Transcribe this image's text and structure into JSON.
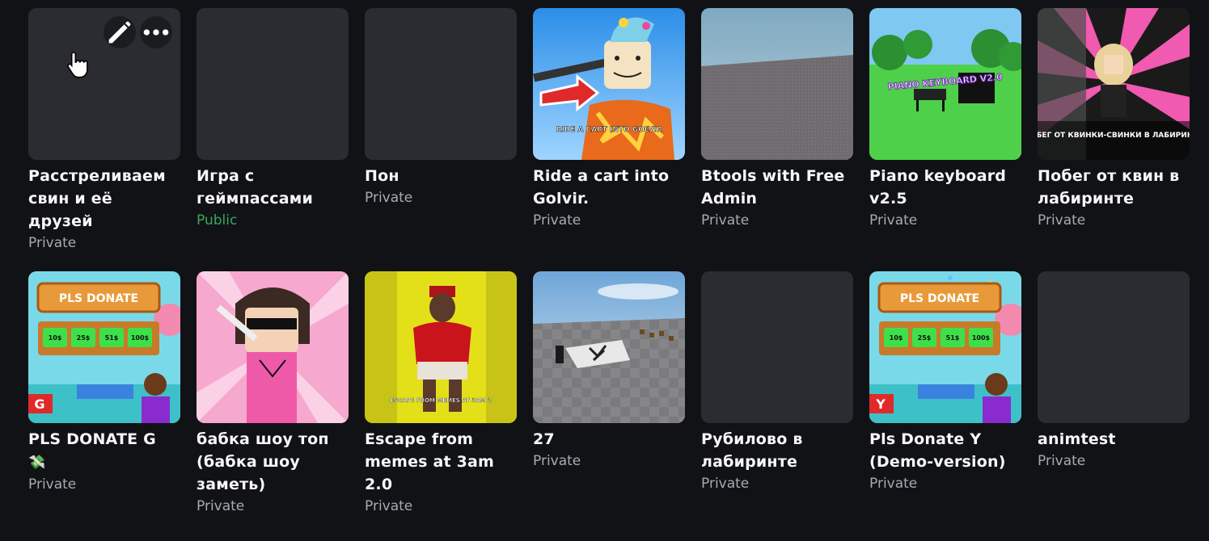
{
  "games": [
    {
      "title": "Расстреливаем свин и её друзей",
      "status": "Private",
      "public": false
    },
    {
      "title": "Игра с геймпассами",
      "status": "Public",
      "public": true
    },
    {
      "title": "Пон",
      "status": "Private",
      "public": false
    },
    {
      "title": "Ride a cart into Golvir.",
      "status": "Private",
      "public": false,
      "thumb_caption": "RIDE A CART INTO GOLVIR"
    },
    {
      "title": "Btools with Free Admin",
      "status": "Private",
      "public": false
    },
    {
      "title": "Piano keyboard v2.5",
      "status": "Private",
      "public": false,
      "thumb_caption": "PIANO KEYBOARD V2.0"
    },
    {
      "title": "Побег от квин в лабиринте",
      "status": "Private",
      "public": false,
      "thumb_caption": "ПОБЕГ ОТ КВИНКИ-СВИНКИ В ЛАБИРИНТЕ"
    },
    {
      "title": "PLS DONATE G",
      "title_emoji": "💸",
      "status": "Private",
      "public": false,
      "thumb_caption": "PLS DONATE",
      "thumb_badge": "G",
      "thumb_prices": [
        "10$",
        "25$",
        "51$",
        "100$"
      ]
    },
    {
      "title": "бабка шоу топ (бабка шоу заметь)",
      "status": "Private",
      "public": false
    },
    {
      "title": "Escape from memes at 3am 2.0",
      "status": "Private",
      "public": false,
      "thumb_caption": "ESCAPE FROM MEMES AT 3AM 2"
    },
    {
      "title": "27",
      "status": "Private",
      "public": false
    },
    {
      "title": "Рубилово в лабиринте",
      "status": "Private",
      "public": false
    },
    {
      "title": "Pls Donate Y (Demo-version)",
      "status": "Private",
      "public": false,
      "thumb_caption": "PLS DONATE",
      "thumb_badge": "Y",
      "thumb_prices": [
        "10$",
        "25$",
        "51$",
        "100$"
      ]
    },
    {
      "title": "animtest",
      "status": "Private",
      "public": false
    }
  ],
  "icons": {
    "edit": "pencil-icon",
    "more": "more-horizontal-icon",
    "cursor": "hand-cursor-icon"
  },
  "colors": {
    "background": "#111216",
    "placeholder": "#2b2c31",
    "public": "#39a85b",
    "private": "#a8aab0"
  }
}
